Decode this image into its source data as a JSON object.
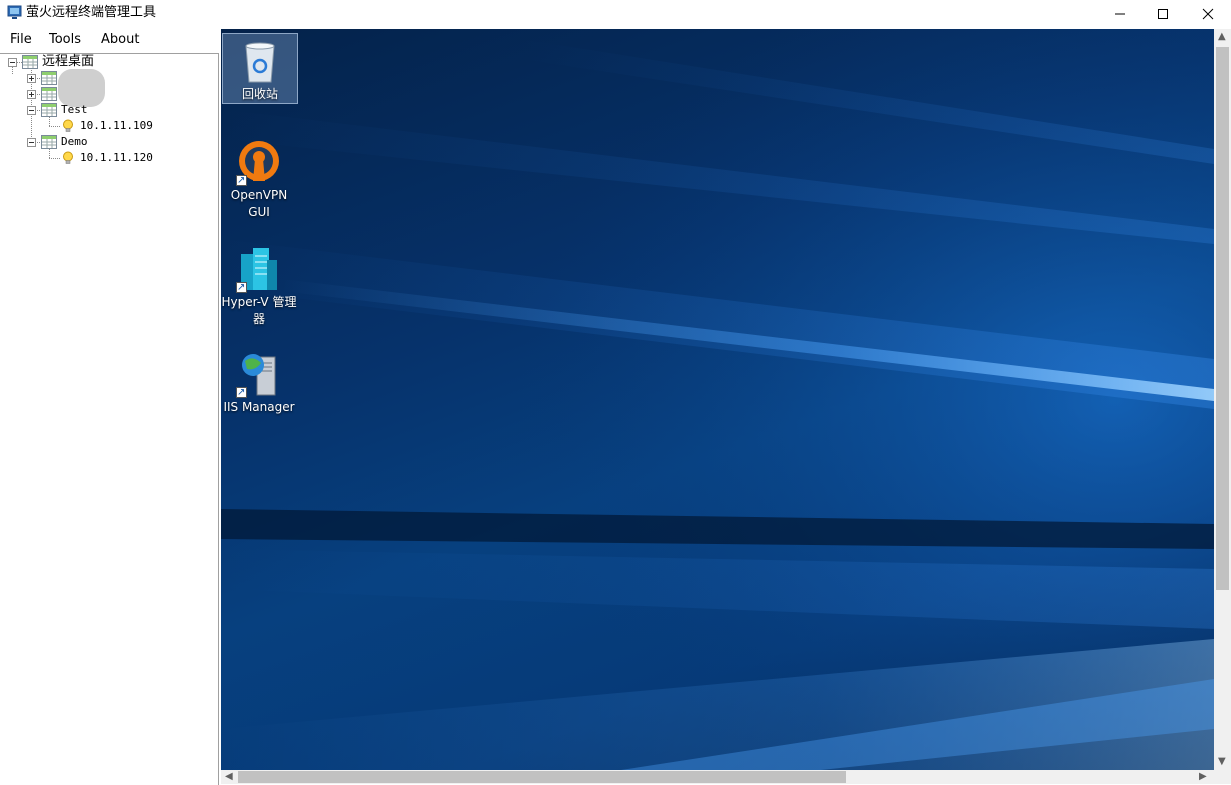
{
  "window": {
    "title": "萤火远程终端管理工具"
  },
  "menu": [
    "File",
    "Tools",
    "About"
  ],
  "tree": {
    "root_label": "远程桌面",
    "groups": [
      {
        "label": "",
        "expanded": false
      },
      {
        "label": "",
        "expanded": false
      },
      {
        "label": "Test",
        "expanded": true,
        "hosts": [
          "10.1.11.109"
        ]
      },
      {
        "label": "Demo",
        "expanded": true,
        "hosts": [
          "10.1.11.120"
        ]
      }
    ]
  },
  "desktop": {
    "icons": [
      {
        "label": "回收站",
        "icon": "recycle-bin-icon",
        "selected": true
      },
      {
        "label": "OpenVPN GUI",
        "icon": "openvpn-icon"
      },
      {
        "label": "Hyper-V 管理器",
        "icon": "hyperv-icon"
      },
      {
        "label": "IIS Manager",
        "icon": "iis-icon"
      }
    ]
  },
  "colors": {
    "desktop_bg": "#06326b",
    "scrollbar_thumb": "#c1c1c1"
  }
}
